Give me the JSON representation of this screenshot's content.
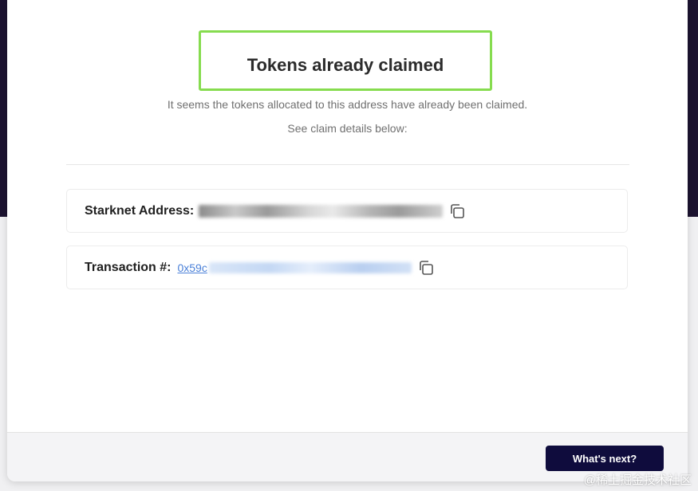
{
  "modal": {
    "title": "Tokens already claimed",
    "description": "It seems the tokens allocated to this address have already been claimed.",
    "details_prompt": "See claim details below:"
  },
  "details": {
    "address": {
      "label": "Starknet Address:",
      "value_redacted": true,
      "copy_icon": "copy-icon"
    },
    "transaction": {
      "label": "Transaction #:",
      "value_visible_prefix": "0x59c",
      "value_redacted": true,
      "copy_icon": "copy-icon"
    }
  },
  "footer": {
    "next_label": "What's next?"
  },
  "watermark": "@稀土掘金技术社区",
  "colors": {
    "title_border": "#86dc4f",
    "button_bg": "#0f0c3d",
    "link": "#4a80d8",
    "backdrop": "#1c1330"
  }
}
